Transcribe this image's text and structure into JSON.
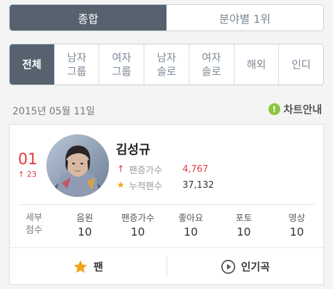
{
  "top_tabs": [
    {
      "label": "종합",
      "active": true
    },
    {
      "label": "분야별 1위",
      "active": false
    }
  ],
  "genre_tabs": [
    {
      "line1": "전체",
      "line2": "",
      "active": true
    },
    {
      "line1": "남자",
      "line2": "그룹",
      "active": false
    },
    {
      "line1": "여자",
      "line2": "그룹",
      "active": false
    },
    {
      "line1": "남자",
      "line2": "솔로",
      "active": false
    },
    {
      "line1": "여자",
      "line2": "솔로",
      "active": false
    },
    {
      "line1": "해외",
      "line2": "",
      "active": false
    },
    {
      "line1": "인디",
      "line2": "",
      "active": false
    }
  ],
  "chart_date": "2015년 05월 11일",
  "chart_guide": {
    "icon": "!",
    "label": "차트안내"
  },
  "entry": {
    "rank": "01",
    "rank_change": "23",
    "artist": "김성규",
    "fan_increase_label": "팬증가수",
    "fan_increase_value": "4,767",
    "fan_total_label": "누적팬수",
    "fan_total_value": "37,132",
    "score_label_line1": "세부",
    "score_label_line2": "점수",
    "scores": [
      {
        "name": "음원",
        "value": "10"
      },
      {
        "name": "팬증가수",
        "value": "10"
      },
      {
        "name": "좋아요",
        "value": "10"
      },
      {
        "name": "포토",
        "value": "10"
      },
      {
        "name": "영상",
        "value": "10"
      }
    ],
    "actions": {
      "fan": "팬",
      "popular_songs": "인기곡"
    }
  },
  "colors": {
    "active_tab": "#56636f",
    "rank_red": "#e0393e",
    "star": "#f5a31a",
    "guide_green": "#8cc63f"
  }
}
